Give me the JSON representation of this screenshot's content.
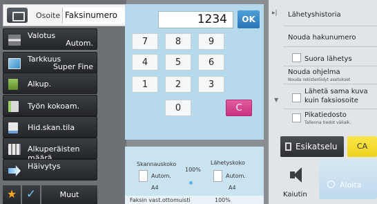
{
  "address": {
    "label": "Osoite",
    "value": "Faksinumero"
  },
  "settings": [
    {
      "label": "Valotus",
      "value": "Autom."
    },
    {
      "label": "Tarkkuus",
      "value": "Super Fine"
    },
    {
      "label": "Alkup.",
      "value": ""
    },
    {
      "label": "Työn kokoam.",
      "value": ""
    },
    {
      "label": "Hid.skan.tila",
      "value": ""
    },
    {
      "label": "Alkuperäisten määrä",
      "value": ""
    },
    {
      "label": "Häivytys",
      "value": ""
    }
  ],
  "bottom_bar": {
    "star_icon": "★",
    "check_icon": "✓",
    "other_label": "Muut"
  },
  "keypad": {
    "display": "1234",
    "ok_label": "OK",
    "keys": [
      "7",
      "8",
      "9",
      "4",
      "5",
      "6",
      "1",
      "2",
      "3",
      "0"
    ],
    "clear_label": "C"
  },
  "scan": {
    "scan_size_label": "Skannauskoko",
    "send_size_label": "Lähetyskoko",
    "scan_mode": "Autom.",
    "send_mode": "Autom.",
    "ratio": "100%",
    "scan_paper": "A4",
    "send_paper": "A4",
    "memory_label": "Faksin vast.ottomuisti",
    "memory_value": "100%"
  },
  "right_panel": {
    "history": "Lähetyshistoria",
    "recall": "Nouda hakunumero",
    "direct_send": "Suora lähetys",
    "program_title": "Nouda ohjelma",
    "program_sub": "Nouda rekisteröidyt asetukset",
    "same_image": "Lähetä sama kuva kuin faksiosoite",
    "quick_file_title": "Pikatiedosto",
    "quick_file_sub": "Tallenna tiedot väliaik.",
    "preview": "Esikatselu",
    "ca": "CA",
    "speaker": "Kaiutin",
    "start": "Aloita"
  },
  "colors": {
    "keypad_bg": "#b7d9ec",
    "ok": "#2b75b5",
    "clear": "#c8307e",
    "ca": "#eed21b",
    "star": "#f6a623",
    "check": "#6fc6ef"
  }
}
